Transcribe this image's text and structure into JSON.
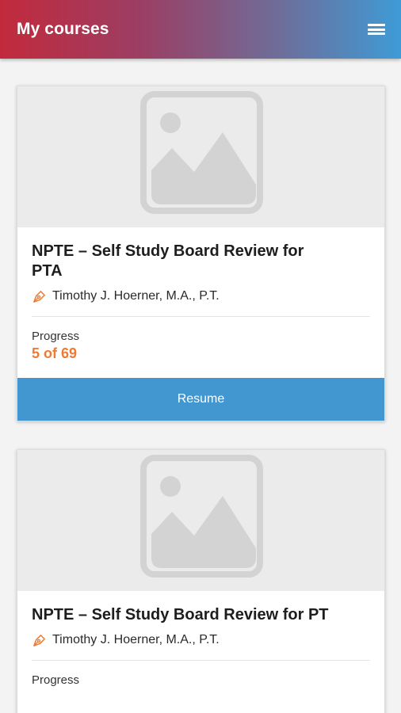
{
  "header": {
    "title": "My courses",
    "menu_icon": "hamburger-menu-icon"
  },
  "courses": [
    {
      "title": "NPTE – Self Study Board Review for PTA",
      "author": "Timothy J. Hoerner, M.A., P.T.",
      "progress_label": "Progress",
      "progress_value": "5 of 69",
      "button_label": "Resume"
    },
    {
      "title": "NPTE – Self Study Board Review for PT",
      "author": "Timothy J. Hoerner, M.A., P.T.",
      "progress_label": "Progress"
    }
  ],
  "colors": {
    "header_gradient_start": "#c22a3c",
    "header_gradient_end": "#3f9bd6",
    "accent_orange": "#ee7a33",
    "button_blue": "#4397d0",
    "image_placeholder_bg": "#ebebeb"
  }
}
